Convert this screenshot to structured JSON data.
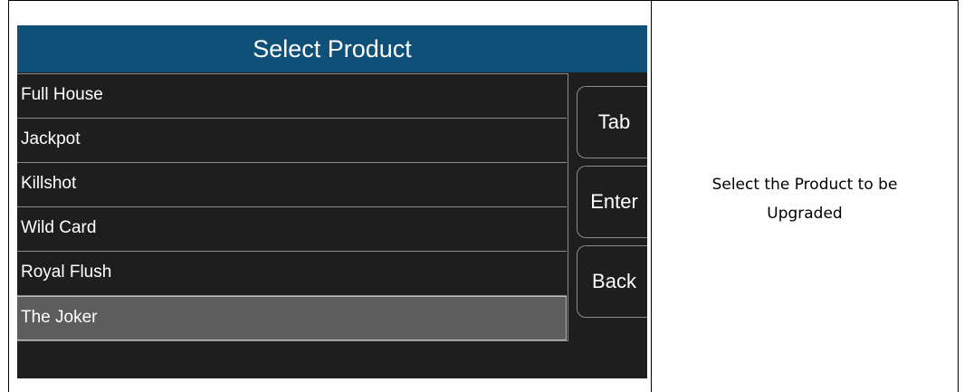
{
  "screen": {
    "title": "Select Product",
    "products": [
      {
        "label": "Full House",
        "selected": false
      },
      {
        "label": "Jackpot",
        "selected": false
      },
      {
        "label": "Killshot",
        "selected": false
      },
      {
        "label": "Wild Card",
        "selected": false
      },
      {
        "label": "Royal Flush",
        "selected": false
      },
      {
        "label": "The Joker",
        "selected": true
      }
    ],
    "buttons": {
      "tab": "Tab",
      "enter": "Enter",
      "back": "Back"
    },
    "colors": {
      "title_bar": "#0f5079",
      "background": "#1e1e1e",
      "selected_row": "#5d5d5d"
    }
  },
  "instruction": {
    "line1": "Select the Product to be",
    "line2": "Upgraded"
  }
}
